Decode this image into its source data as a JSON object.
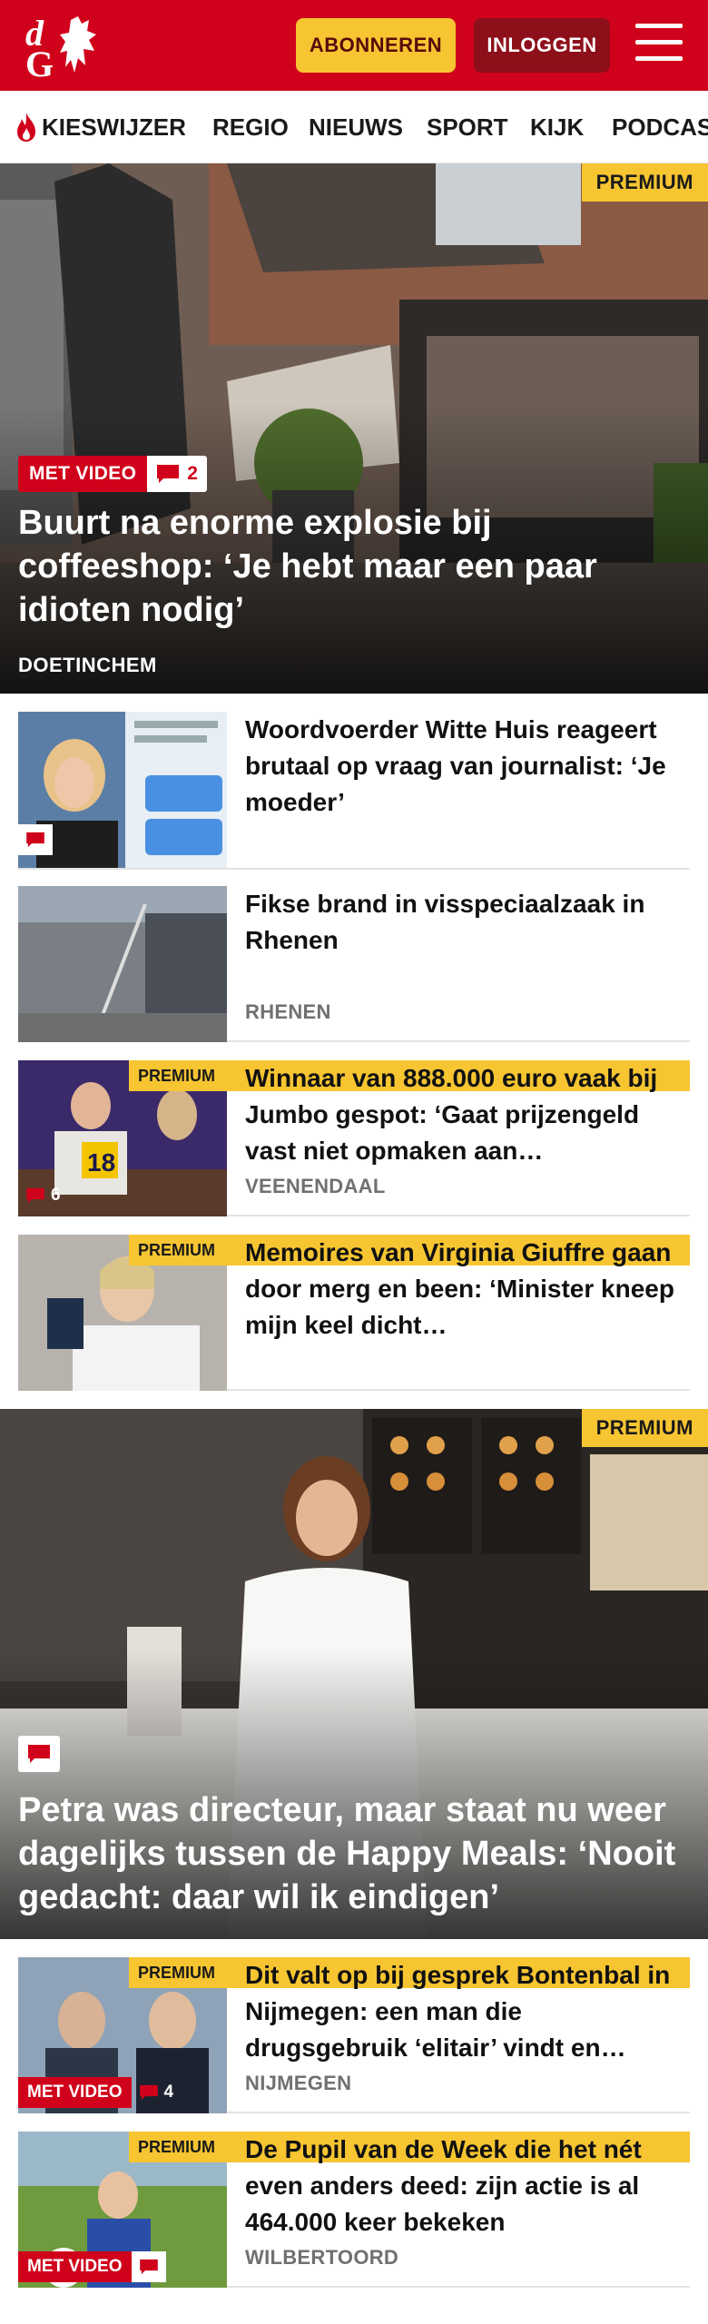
{
  "header": {
    "logo_text": "dG",
    "subscribe_label": "ABONNEREN",
    "login_label": "INLOGGEN",
    "menu_icon": "hamburger-menu-icon",
    "brand_color": "#d0021b",
    "accent_color": "#f7c531"
  },
  "nav": {
    "items": [
      {
        "label": "KIESWIJZER",
        "icon": "flame-icon"
      },
      {
        "label": "REGIO"
      },
      {
        "label": "NIEUWS"
      },
      {
        "label": "SPORT"
      },
      {
        "label": "KIJK"
      },
      {
        "label": "PODCAS"
      }
    ]
  },
  "hero1": {
    "premium": "PREMIUM",
    "video_label": "MET VIDEO",
    "comments": "2",
    "title": "Buurt na enorme explosie bij coffeeshop: ‘Je hebt maar een paar idioten nodig’",
    "place": "DOETINCHEM"
  },
  "list1": [
    {
      "title": "Woordvoerder Witte Huis reageert brutaal op vraag van journalist: ‘Je moeder’",
      "place": "",
      "premium": "",
      "video": "",
      "comments": ""
    },
    {
      "title": "Fikse brand in visspeciaalzaak in Rhenen",
      "place": "RHENEN",
      "premium": "",
      "video": "",
      "comments": ""
    },
    {
      "title": "Winnaar van 888.000 euro vaak bij Jumbo gespot: ‘Gaat prijzen­geld vast niet opmaken aan…",
      "place": "VEENENDAAL",
      "premium": "PREMIUM",
      "video": "",
      "comments": "6"
    },
    {
      "title": "Memoires van Virginia Giuffre gaan door merg en been: ‘Minister kneep mijn keel dicht…",
      "place": "",
      "premium": "PREMIUM",
      "video": "",
      "comments": ""
    }
  ],
  "hero2": {
    "premium": "PREMIUM",
    "title": "Petra was directeur, maar staat nu weer dagelijks tussen de Happy Meals: ‘Nooit gedacht: daar wil ik eindigen’"
  },
  "list2": [
    {
      "title": "Dit valt op bij gesprek Bontenbal in Nijmegen: een man die drugsgebruik ‘elitair’ vindt en…",
      "place": "NIJMEGEN",
      "premium": "PREMIUM",
      "video": "MET VIDEO",
      "comments": "4"
    },
    {
      "title": "De Pupil van de Week die het nét even anders deed: zijn actie is al 464.000 keer bekeken",
      "place": "WILBERTOORD",
      "premium": "PREMIUM",
      "video": "MET VIDEO",
      "comments": ""
    }
  ]
}
